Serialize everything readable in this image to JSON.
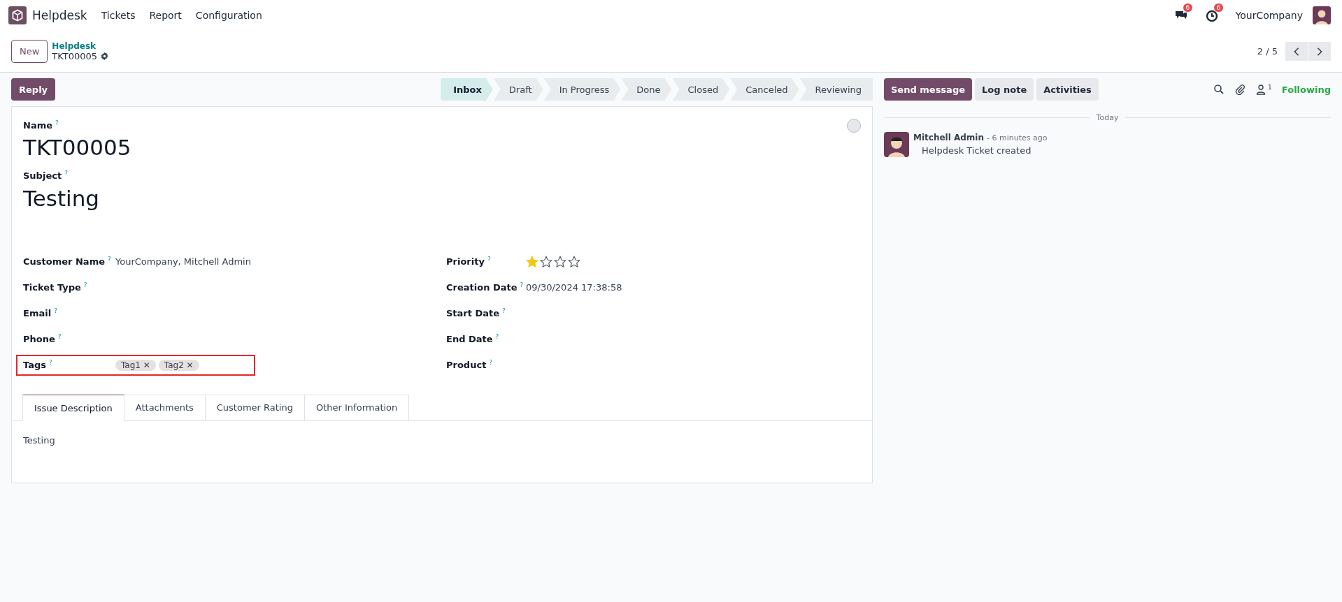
{
  "navbar": {
    "app": "Helpdesk",
    "menu": [
      "Tickets",
      "Report",
      "Configuration"
    ],
    "messages_badge": "6",
    "activities_badge": "6",
    "company": "YourCompany"
  },
  "breadcrumb": {
    "new": "New",
    "parent": "Helpdesk",
    "current": "TKT00005"
  },
  "pager": {
    "text": "2 / 5"
  },
  "reply": "Reply",
  "stages": [
    {
      "label": "Inbox",
      "selected": true
    },
    {
      "label": "Draft",
      "selected": false
    },
    {
      "label": "In Progress",
      "selected": false
    },
    {
      "label": "Done",
      "selected": false
    },
    {
      "label": "Closed",
      "selected": false
    },
    {
      "label": "Canceled",
      "selected": false
    },
    {
      "label": "Reviewing",
      "selected": false
    }
  ],
  "form": {
    "name": {
      "label": "Name",
      "help": "?",
      "value": "TKT00005"
    },
    "subject": {
      "label": "Subject",
      "help": "?",
      "value": "Testing"
    },
    "left_fields": [
      {
        "label": "Customer Name",
        "help": "?",
        "kind": "text",
        "value": "YourCompany, Mitchell Admin",
        "highlighted": false
      },
      {
        "label": "Ticket Type",
        "help": "?",
        "kind": "text",
        "highlighted": false
      },
      {
        "label": "Email",
        "help": "?",
        "kind": "text",
        "highlighted": false
      },
      {
        "label": "Phone",
        "help": "?",
        "kind": "text",
        "highlighted": false
      },
      {
        "label": "Tags",
        "help": "?",
        "kind": "tags",
        "tags": [
          "Tag1",
          "Tag2"
        ],
        "remove": "✕",
        "highlighted": true
      }
    ],
    "right_fields": [
      {
        "label": "Priority",
        "help": "?",
        "kind": "stars",
        "stars": 1,
        "highlighted": false
      },
      {
        "label": "Creation Date",
        "help": "?",
        "kind": "text",
        "value": "09/30/2024 17:38:58",
        "highlighted": false
      },
      {
        "label": "Start Date",
        "help": "?",
        "kind": "text",
        "highlighted": false
      },
      {
        "label": "End Date",
        "help": "?",
        "kind": "text",
        "highlighted": false
      },
      {
        "label": "Product",
        "help": "?",
        "kind": "text",
        "highlighted": false
      }
    ],
    "tabs": [
      {
        "label": "Issue Description",
        "selected": true
      },
      {
        "label": "Attachments",
        "selected": false
      },
      {
        "label": "Customer Rating",
        "selected": false
      },
      {
        "label": "Other Information",
        "selected": false
      }
    ],
    "tab_content": "Testing"
  },
  "chatter": {
    "buttons": [
      "Send message",
      "Log note",
      "Activities"
    ],
    "followers_count": "1",
    "following": "Following",
    "date_separator": "Today",
    "messages": [
      {
        "author": "Mitchell Admin",
        "time": "- 6 minutes ago",
        "body": "Helpdesk Ticket created"
      }
    ]
  }
}
